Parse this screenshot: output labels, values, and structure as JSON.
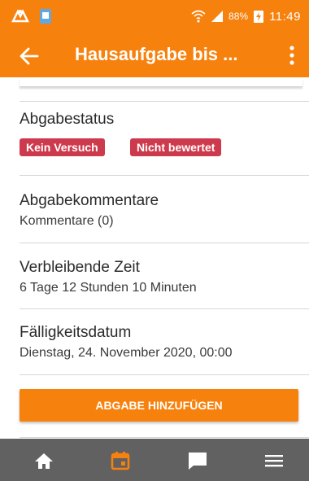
{
  "status_bar": {
    "battery": "88%",
    "time": "11:49"
  },
  "app_bar": {
    "title": "Hausaufgabe bis ..."
  },
  "sections": {
    "abgabestatus": {
      "title": "Abgabestatus",
      "badges": [
        "Kein Versuch",
        "Nicht bewertet"
      ]
    },
    "kommentare": {
      "title": "Abgabekommentare",
      "value": "Kommentare (0)"
    },
    "zeit": {
      "title": "Verbleibende Zeit",
      "value": "6 Tage 12 Stunden 10 Minuten"
    },
    "faelligkeit": {
      "title": "Fälligkeitsdatum",
      "value": "Dienstag, 24. November 2020, 00:00"
    }
  },
  "submit_button": {
    "label": "ABGABE HINZUFÜGEN"
  },
  "bottom_nav": {
    "items": [
      "home-icon",
      "calendar-icon",
      "messages-icon",
      "menu-icon"
    ],
    "active": "calendar-icon"
  },
  "colors": {
    "accent": "#f7810d",
    "badge": "#ce3a4d",
    "nav_bg": "#616161"
  }
}
